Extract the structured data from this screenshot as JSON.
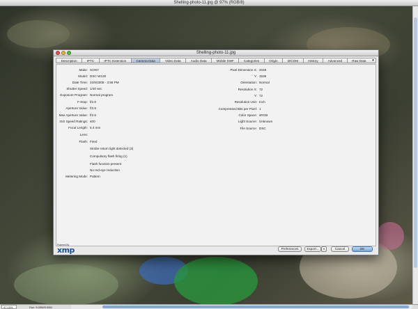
{
  "app": {
    "window_title": "Shelling-photo-11.jpg @ 97% (RGB/8)"
  },
  "statusbar": {
    "zoom": "97.15%",
    "doc_info": "Doc: 5.00M/5.00M"
  },
  "dialog": {
    "title": "Shelling-photo-11.jpg",
    "tabs": [
      {
        "label": "Description",
        "active": false
      },
      {
        "label": "IPTC",
        "active": false
      },
      {
        "label": "IPTC Extension",
        "active": false
      },
      {
        "label": "Camera Data",
        "active": true
      },
      {
        "label": "Video Data",
        "active": false
      },
      {
        "label": "Audio Data",
        "active": false
      },
      {
        "label": "Mobile SWF",
        "active": false
      },
      {
        "label": "Categories",
        "active": false
      },
      {
        "label": "Origin",
        "active": false
      },
      {
        "label": "DICOM",
        "active": false
      },
      {
        "label": "History",
        "active": false
      },
      {
        "label": "Advanced",
        "active": false
      },
      {
        "label": "Raw Data",
        "active": false
      }
    ],
    "tab_menu_icon": "chevron-down-icon",
    "left_fields": [
      {
        "label": "Make:",
        "value": "SONY"
      },
      {
        "label": "Model:",
        "value": "DSC-W130"
      },
      {
        "label": "Date Time:",
        "value": "22/8/2008 - 3:58 PM"
      },
      {
        "label": "Shutter Speed:",
        "value": "1/40 sec"
      },
      {
        "label": "Exposure Program:",
        "value": "Normal program"
      },
      {
        "label": "F-Stop:",
        "value": "f/2.8"
      },
      {
        "label": "Aperture Value:",
        "value": "f/2.8"
      },
      {
        "label": "Max Aperture Value:",
        "value": "f/2.8"
      },
      {
        "label": "ISO Speed Ratings:",
        "value": "400"
      },
      {
        "label": "Focal Length:",
        "value": "5.4 mm"
      },
      {
        "label": "Lens:",
        "value": ""
      },
      {
        "label": "Flash:",
        "value": "Fired"
      }
    ],
    "flash_details": [
      "Strobe return light detected (3)",
      "Compulsory flash firing (1)",
      "Flash function present",
      "No red-eye reduction"
    ],
    "metering": {
      "label": "Metering Mode:",
      "value": "Pattern"
    },
    "right_fields": [
      {
        "label": "Pixel Dimension X:",
        "value": "2048"
      },
      {
        "label": "Y:",
        "value": "1536"
      },
      {
        "label": "Orientation:",
        "value": "Normal"
      },
      {
        "label": "Resolution X:",
        "value": "72"
      },
      {
        "label": "Y:",
        "value": "72"
      },
      {
        "label": "Resolution Unit:",
        "value": "Inch"
      },
      {
        "label": "Compressed Bits per Pixel:",
        "value": "1"
      },
      {
        "label": "Color Space:",
        "value": "sRGB"
      },
      {
        "label": "Light Source:",
        "value": "Unknown"
      },
      {
        "label": "File Source:",
        "value": "DSC"
      }
    ],
    "logo": {
      "powered_by": "Powered By",
      "word": "xmp"
    },
    "buttons": {
      "preferences": "Preferences",
      "export": "Export...",
      "cancel": "Cancel",
      "ok": "OK"
    }
  }
}
